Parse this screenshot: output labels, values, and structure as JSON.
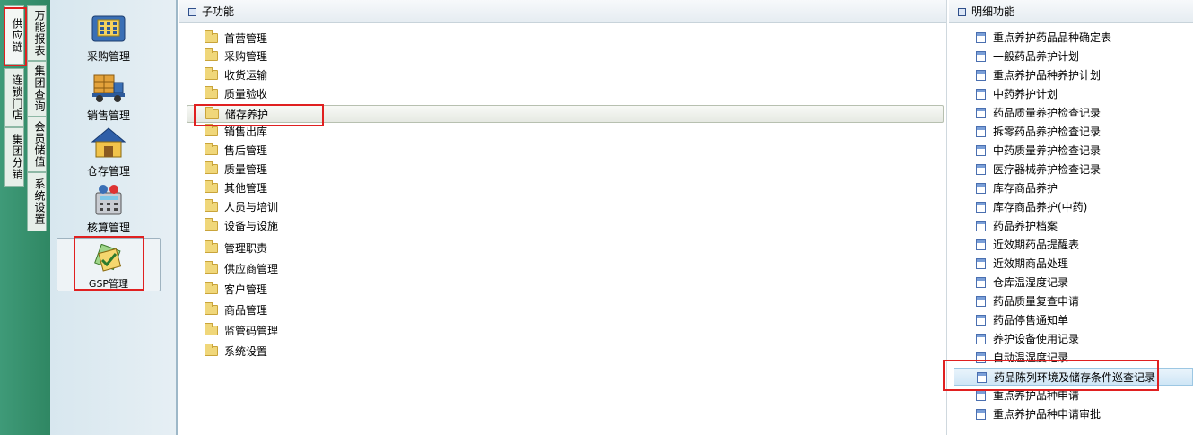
{
  "left_tabs": {
    "col1": [
      "供应链",
      "连锁门店",
      "集团分销"
    ],
    "col2": [
      "万能报表",
      "集团查询",
      "会员储值",
      "系统设置"
    ]
  },
  "modules": [
    {
      "label": "采购管理",
      "icon": "purchase-icon"
    },
    {
      "label": "销售管理",
      "icon": "delivery-truck-icon"
    },
    {
      "label": "仓存管理",
      "icon": "warehouse-icon"
    },
    {
      "label": "核算管理",
      "icon": "calculator-icon"
    },
    {
      "label": "GSP管理",
      "icon": "gsp-icon"
    }
  ],
  "sub_panel": {
    "header": "子功能",
    "items": [
      "首营管理",
      "采购管理",
      "收货运输",
      "质量验收",
      "储存养护",
      "销售出库",
      "售后管理",
      "质量管理",
      "其他管理",
      "人员与培训",
      "设备与设施",
      "管理职责",
      "供应商管理",
      "客户管理",
      "商品管理",
      "监管码管理",
      "系统设置"
    ],
    "selected_index": 4
  },
  "detail_panel": {
    "header": "明细功能",
    "items": [
      "重点养护药品品种确定表",
      "一般药品养护计划",
      "重点养护品种养护计划",
      "中药养护计划",
      "药品质量养护检查记录",
      "拆零药品养护检查记录",
      "中药质量养护检查记录",
      "医疗器械养护检查记录",
      "库存商品养护",
      "库存商品养护(中药)",
      "药品养护档案",
      "近效期药品提醒表",
      "近效期商品处理",
      "仓库温湿度记录",
      "药品质量复查申请",
      "药品停售通知单",
      "养护设备使用记录",
      "自动温湿度记录",
      "药品陈列环境及储存条件巡查记录",
      "重点养护品种申请",
      "重点养护品种申请审批"
    ],
    "selected_index": 18
  },
  "colors": {
    "strip_green": "#3f9a78",
    "highlight_red": "#e02020",
    "selection_blue": "#cfe6f6"
  }
}
